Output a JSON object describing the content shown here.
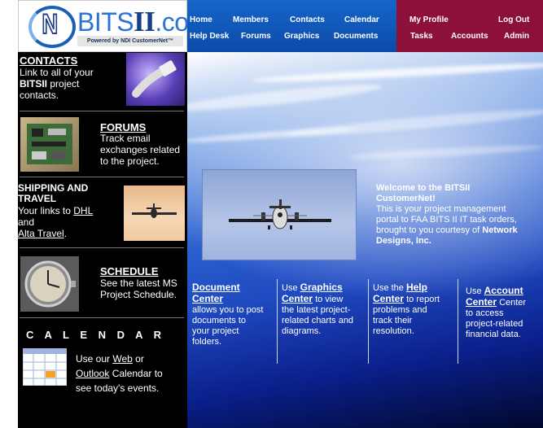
{
  "logo": {
    "brand_bits": "BITS",
    "brand_ii": "II",
    "brand_com": ".com",
    "tagline": "Powered by NDI CustomerNet™"
  },
  "nav_main": {
    "home": "Home",
    "members": "Members",
    "contacts": "Contacts",
    "calendar": "Calendar",
    "help_desk": "Help Desk",
    "forums": "Forums",
    "graphics": "Graphics",
    "documents": "Documents"
  },
  "nav_user": {
    "my_profile": "My Profile",
    "log_out": "Log Out",
    "tasks": "Tasks",
    "accounts": "Accounts",
    "admin": "Admin"
  },
  "sidebar": {
    "contacts": {
      "title": "CONTACTS",
      "line1": "Link to all of your",
      "bold": "BITSII",
      "line2": " project",
      "line3": "contacts."
    },
    "forums": {
      "title": "FORUMS",
      "text1": "Track email",
      "text2": "exchanges related",
      "text3": "to the project."
    },
    "shipping": {
      "title1": "SHIPPING AND",
      "title2": "TRAVEL",
      "line1": "Your links to ",
      "dhl": "DHL",
      "and": "and",
      "alta": "Alta Travel",
      "period": "."
    },
    "schedule": {
      "title": "SCHEDULE",
      "text1": "See the latest MS",
      "text2": "Project Schedule."
    },
    "calendar": {
      "title": "C A L E N D A R",
      "line1a": "Use our ",
      "web": "Web",
      "line1b": " or",
      "outlook": "Outlook",
      "line2b": " Calendar to",
      "line3": "see today's events."
    }
  },
  "welcome": {
    "title1": "Welcome to the BITSII",
    "title2": "CustomerNet!",
    "body1": "This is your project management",
    "body2": "portal to FAA BITS II IT task orders,",
    "body3": "brought to you courtesy of ",
    "company1": "Network",
    "company2": "Designs, Inc."
  },
  "columns": {
    "document": {
      "link1": "Document",
      "link2": "Center",
      "t1": "allows you to post",
      "t2": "documents to",
      "t3": "your project",
      "t4": "folders."
    },
    "graphics": {
      "pre": "Use ",
      "link1": "Graphics",
      "link2": "Center",
      "t1": " to view",
      "t2": "the latest project-",
      "t3": "related charts and",
      "t4": "diagrams."
    },
    "help": {
      "pre": "Use the ",
      "link1": "Help",
      "link2": "Center",
      "t1": " to report",
      "t2": "problems and",
      "t3": "track their",
      "t4": "resolution."
    },
    "account": {
      "pre": "Use ",
      "link1": "Account",
      "link2": "Center",
      "t1": " Center",
      "t2": "to access",
      "t3": "project-related",
      "t4": "financial data."
    }
  },
  "colors": {
    "nav_blue": "#1566c8",
    "nav_red": "#8c1038",
    "background": "#000000"
  }
}
